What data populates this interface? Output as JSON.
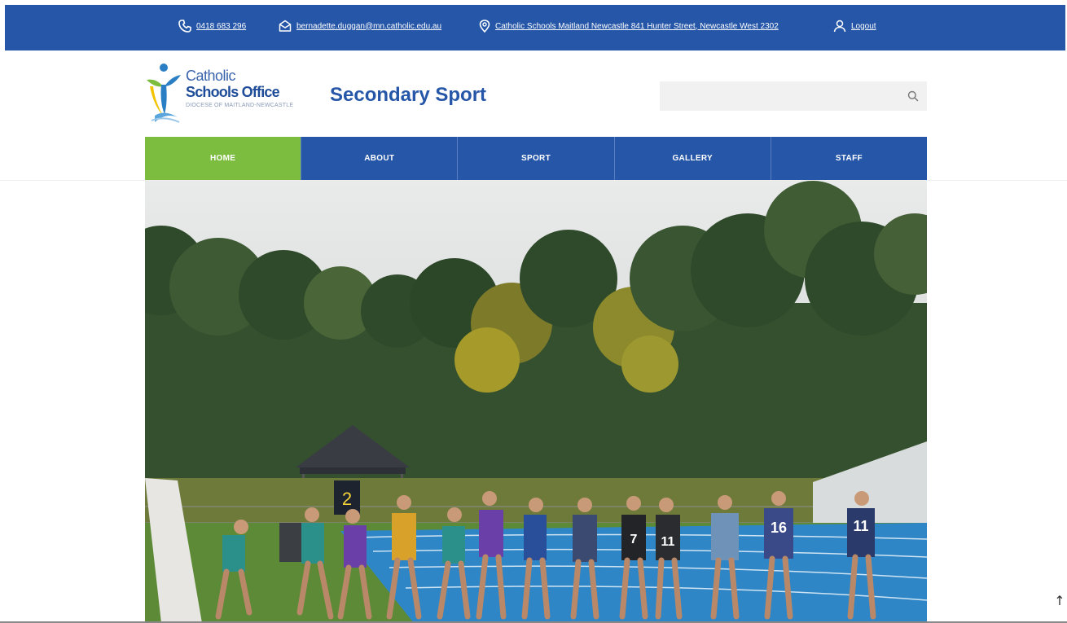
{
  "topbar": {
    "phone": "0418 683 296",
    "email": "bernadette.duggan@mn.catholic.edu.au",
    "address": "Catholic Schools Maitland Newcastle 841 Hunter Street, Newcastle West 2302",
    "logout": "Logout",
    "icons": [
      "phone-icon",
      "mail-icon",
      "location-pin-icon",
      "user-icon"
    ]
  },
  "logo": {
    "line1": "Catholic",
    "line2": "Schools Office",
    "line3": "DIOCESE OF MAITLAND-NEWCASTLE"
  },
  "header": {
    "site_title": "Secondary Sport",
    "search_placeholder": ""
  },
  "nav": {
    "items": [
      {
        "label": "HOME",
        "active": true
      },
      {
        "label": "ABOUT",
        "active": false
      },
      {
        "label": "SPORT",
        "active": false
      },
      {
        "label": "GALLERY",
        "active": false
      },
      {
        "label": "STAFF",
        "active": false
      }
    ]
  },
  "hero": {
    "bibs": [
      "7",
      "11",
      "16",
      "11"
    ],
    "clock": "2"
  },
  "colors": {
    "brand_blue": "#2556a8",
    "active_green": "#7cbd3f",
    "track_blue": "#2f86c7"
  }
}
